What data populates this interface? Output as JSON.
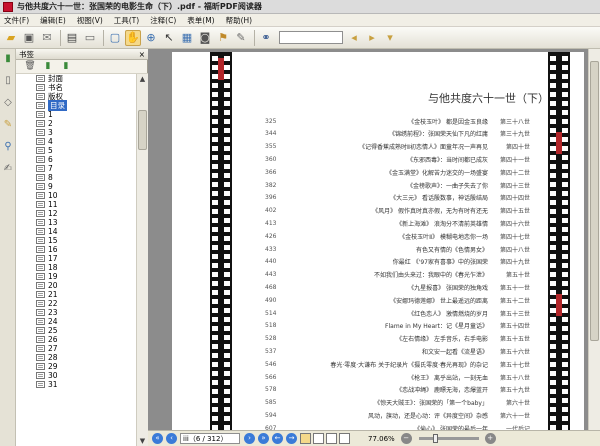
{
  "window": {
    "title": "与他共度六十一世：张国荣的电影生命（下）.pdf - 福昕PDF阅读器"
  },
  "menu": [
    "文件(F)",
    "编辑(E)",
    "视图(V)",
    "工具(T)",
    "注释(C)",
    "表单(M)",
    "帮助(H)"
  ],
  "toolbar": {
    "icons": [
      "open-icon",
      "save-icon",
      "email-icon",
      "print-icon",
      "scan-icon",
      "fullscreen-icon",
      "hand-icon",
      "zoom-icon",
      "select-icon",
      "snapshot-icon",
      "camera-icon",
      "stamp-icon",
      "pen-icon",
      "binoculars-icon",
      "prev-result-icon",
      "next-result-icon",
      "doc-menu-icon"
    ]
  },
  "sidebar": {
    "header": "书签",
    "bookmarks": [
      {
        "label": "封面",
        "selected": false
      },
      {
        "label": "书名",
        "selected": false
      },
      {
        "label": "版权",
        "selected": false
      },
      {
        "label": "目录",
        "selected": true
      },
      {
        "label": "1"
      },
      {
        "label": "2"
      },
      {
        "label": "3"
      },
      {
        "label": "4"
      },
      {
        "label": "5"
      },
      {
        "label": "6"
      },
      {
        "label": "7"
      },
      {
        "label": "8"
      },
      {
        "label": "9"
      },
      {
        "label": "10"
      },
      {
        "label": "11"
      },
      {
        "label": "12"
      },
      {
        "label": "13"
      },
      {
        "label": "14"
      },
      {
        "label": "15"
      },
      {
        "label": "16"
      },
      {
        "label": "17"
      },
      {
        "label": "18"
      },
      {
        "label": "19"
      },
      {
        "label": "20"
      },
      {
        "label": "21"
      },
      {
        "label": "22"
      },
      {
        "label": "23"
      },
      {
        "label": "24"
      },
      {
        "label": "25"
      },
      {
        "label": "26"
      },
      {
        "label": "27"
      },
      {
        "label": "28"
      },
      {
        "label": "29"
      },
      {
        "label": "30"
      },
      {
        "label": "31"
      }
    ]
  },
  "page": {
    "title": "与他共度六十一世（下）",
    "toc": [
      {
        "num": "325",
        "entry": "《金枝玉叶》 都是因金玉良缘",
        "chapter": "第三十八世"
      },
      {
        "num": "344",
        "entry": "《锦绣前程》：张国荣天仙下凡的红庸",
        "chapter": "第三十九世"
      },
      {
        "num": "355",
        "entry": "《记得香蕉成熟时Ⅱ初恋情人》面童年况一声再见",
        "chapter": "第四十世"
      },
      {
        "num": "360",
        "entry": "《东邪西毒》：当时间都已成灰",
        "chapter": "第四十一世"
      },
      {
        "num": "366",
        "entry": "《金玉满堂》化解苦力迷交的一场盛宴",
        "chapter": "第四十二世"
      },
      {
        "num": "382",
        "entry": "《金榜歌声》：一曲子失去了你",
        "chapter": "第四十三世"
      },
      {
        "num": "396",
        "entry": "《大三元》 看话殷数事，神话殷结局",
        "chapter": "第四十四世"
      },
      {
        "num": "402",
        "entry": "《风月》 假作真时真亦假，无为有时有还无",
        "chapter": "第四十五世"
      },
      {
        "num": "413",
        "entry": "《新上海滩》 浪淘分不清前英雄情",
        "chapter": "第四十六世"
      },
      {
        "num": "426",
        "entry": "《金枝玉叶Ⅱ》 模糊电地恋你一场",
        "chapter": "第四十七世"
      },
      {
        "num": "433",
        "entry": "有色又有情的《色情男女》",
        "chapter": "第四十八世"
      },
      {
        "num": "440",
        "entry": "你最红 《'97家有喜事》中的张国荣",
        "chapter": "第四十九世"
      },
      {
        "num": "443",
        "entry": "不如我们由头来过：我眼中的《春光乍泄》",
        "chapter": "第五十世"
      },
      {
        "num": "468",
        "entry": "《九星报喜》 张国荣的独角戏",
        "chapter": "第五十一世"
      },
      {
        "num": "490",
        "entry": "《安娜玛德莲娜》 世上最遥远的距离",
        "chapter": "第五十二世"
      },
      {
        "num": "514",
        "entry": "《红色恋人》 激情燃烧的岁月",
        "chapter": "第五十三世"
      },
      {
        "num": "518",
        "entry": "Flame in My Heart：记《星月童话》",
        "chapter": "第五十四世"
      },
      {
        "num": "528",
        "entry": "《左右情缘》 左手音乐，右手电影",
        "chapter": "第五十五世"
      },
      {
        "num": "537",
        "entry": "和文安一起看《流星语》",
        "chapter": "第五十六世"
      },
      {
        "num": "546",
        "entry": "春光·零度·大谦布 关于纪录片《摄氏零度·春光再现》的杂记",
        "chapter": "第五十七世"
      },
      {
        "num": "566",
        "entry": "《枪王》 离乎出站，一刻无血",
        "chapter": "第五十八世"
      },
      {
        "num": "578",
        "entry": "《恋战冲绳》 鹿瞟无海，恋爆蓝开",
        "chapter": "第五十九世"
      },
      {
        "num": "585",
        "entry": "《惊天大贼王》：张国荣的「第一个baby」",
        "chapter": "第六十世"
      },
      {
        "num": "594",
        "entry": "风动，旗动，还是心动：评《异度空间》杂感",
        "chapter": "第六十一世"
      },
      {
        "num": "607",
        "entry": "《偷心》 张国荣的最后一年",
        "chapter": "一代后记"
      }
    ]
  },
  "status": {
    "page_display": "iii（6 / 312）",
    "zoom": "77.06%"
  }
}
